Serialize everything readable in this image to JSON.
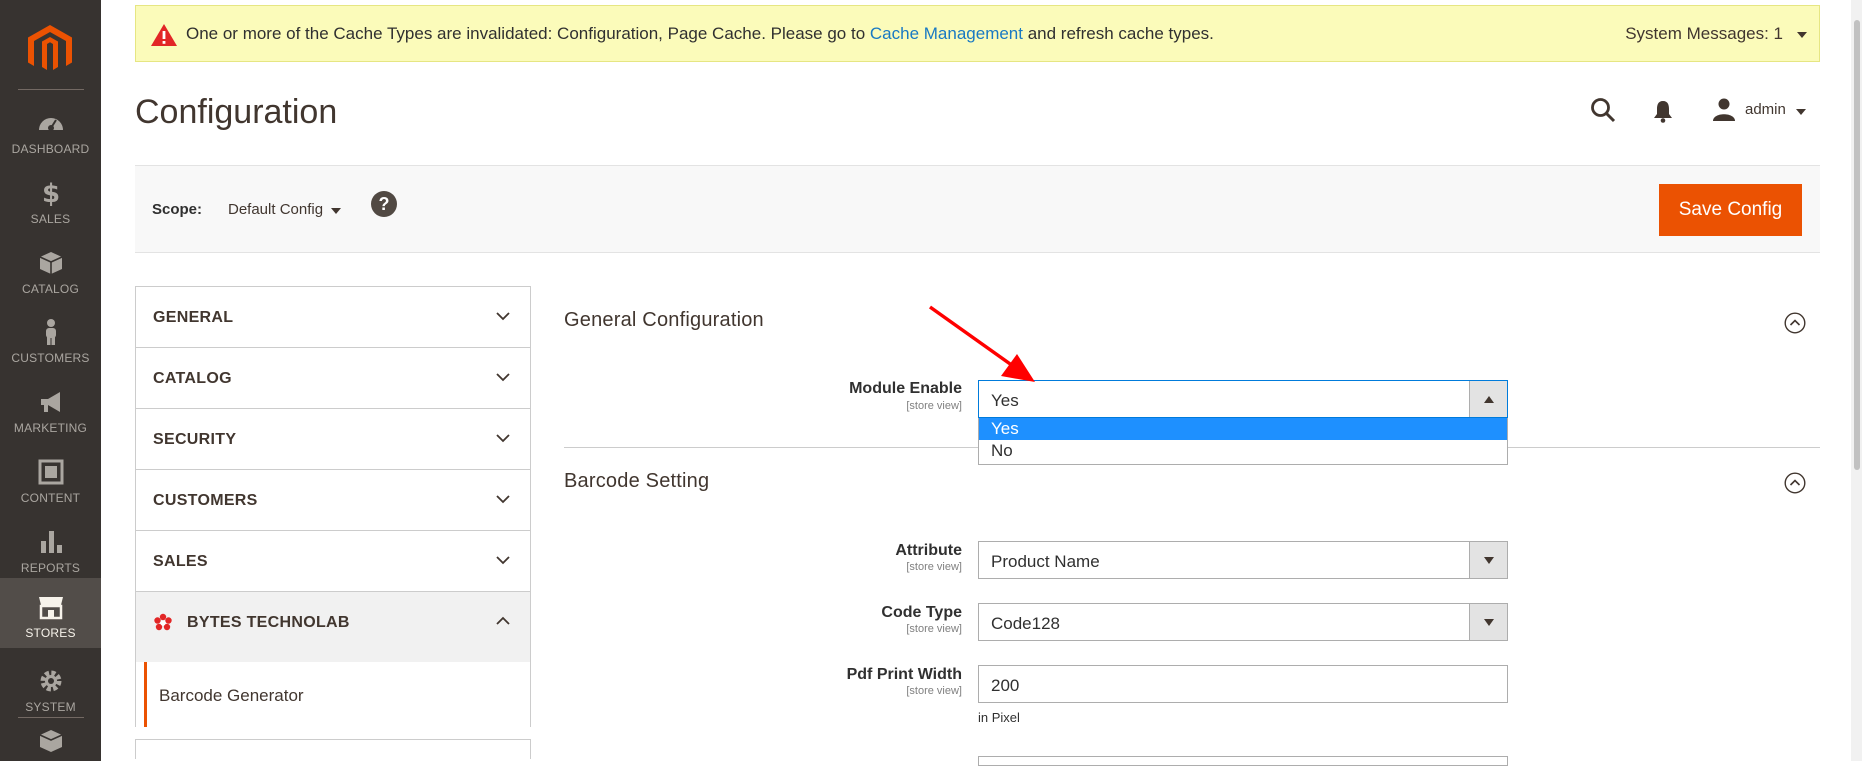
{
  "sidebar": {
    "items": [
      {
        "label": "DASHBOARD",
        "icon": "dashboard-icon"
      },
      {
        "label": "SALES",
        "icon": "dollar-icon"
      },
      {
        "label": "CATALOG",
        "icon": "box-icon"
      },
      {
        "label": "CUSTOMERS",
        "icon": "person-icon"
      },
      {
        "label": "MARKETING",
        "icon": "megaphone-icon"
      },
      {
        "label": "CONTENT",
        "icon": "content-icon"
      },
      {
        "label": "REPORTS",
        "icon": "bar-chart-icon"
      },
      {
        "label": "STORES",
        "icon": "store-icon",
        "active": true
      },
      {
        "label": "SYSTEM",
        "icon": "gear-icon"
      }
    ]
  },
  "system_message": {
    "text_before": "One or more of the Cache Types are invalidated: Configuration, Page Cache. Please go to ",
    "link": "Cache Management",
    "text_after": " and refresh cache types.",
    "count_label": "System Messages: 1"
  },
  "header": {
    "title": "Configuration",
    "user": "admin"
  },
  "scope": {
    "label": "Scope:",
    "value": "Default Config",
    "help": "?",
    "save_label": "Save Config"
  },
  "tabs": {
    "general": "GENERAL",
    "catalog": "CATALOG",
    "security": "SECURITY",
    "customers": "CUSTOMERS",
    "sales": "SALES",
    "bytes": "BYTES TECHNOLAB",
    "barcode_generator": "Barcode Generator"
  },
  "sections": {
    "general_title": "General Configuration",
    "barcode_title": "Barcode Setting"
  },
  "fields": {
    "module_enable": {
      "label": "Module Enable",
      "scope": "[store view]",
      "value": "Yes",
      "options": [
        "Yes",
        "No"
      ]
    },
    "attribute": {
      "label": "Attribute",
      "scope": "[store view]",
      "value": "Product Name"
    },
    "code_type": {
      "label": "Code Type",
      "scope": "[store view]",
      "value": "Code128"
    },
    "pdf_width": {
      "label": "Pdf Print Width",
      "scope": "[store view]",
      "value": "200",
      "note": "in Pixel"
    }
  },
  "colors": {
    "accent": "#eb5202",
    "sidebar": "#373330",
    "selected_option": "#1e90ff",
    "annotation_arrow": "#ff0000"
  }
}
